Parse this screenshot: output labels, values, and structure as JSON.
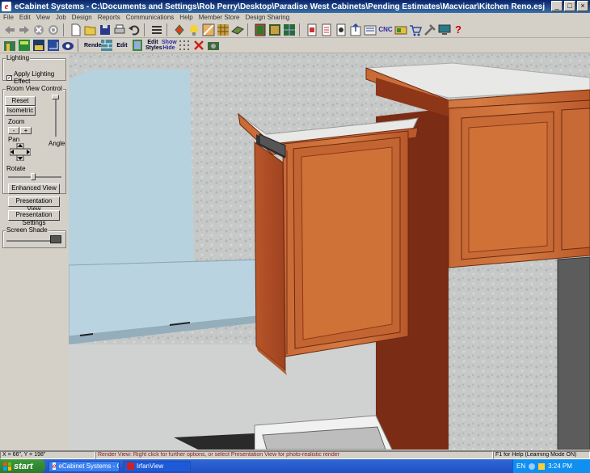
{
  "window": {
    "logo": "e",
    "title": "eCabinet Systems - C:\\Documents and Settings\\Rob Perry\\Desktop\\Paradise West Cabinets\\Pending Estimates\\Macvicar\\Kitchen Reno.esj",
    "minimize": "_",
    "maximize": "□",
    "close": "×"
  },
  "menu": [
    "File",
    "Edit",
    "View",
    "Job",
    "Design",
    "Reports",
    "Communications",
    "Help",
    "Member Store",
    "Design Sharing"
  ],
  "toolbar": {
    "cnc_label": "CNC",
    "help_label": "?",
    "render_label": "Render",
    "edit_label": "Edit",
    "edit_styles_label": "Edit Styles",
    "show_hide_label": "Show Hide"
  },
  "left_panel": {
    "lighting_title": "Lighting",
    "apply_lighting": "Apply Lighting Effect",
    "room_view_title": "Room View Control",
    "reset_view": "Reset View",
    "isometric": "Isometric",
    "zoom": "Zoom",
    "zoom_minus": "-",
    "zoom_plus": "+",
    "pan": "Pan",
    "angle": "Angle",
    "rotate": "Rotate",
    "enhanced_view": "Enhanced View",
    "presentation_view": "Presentation View",
    "presentation_settings": "Presentation Settings",
    "screen_shade": "Screen Shade"
  },
  "status": {
    "coords": "X = 66\", Y = 198\"",
    "message": "Render View: Right click for further options, or select Presentation View for photo-realistic render",
    "help": "F1 for Help (Learning Mode ON)"
  },
  "taskbar": {
    "start": "start",
    "task1": "eCabinet Systems - C...",
    "task2": "IrfanView",
    "lang": "EN",
    "time": "3:24 PM"
  },
  "colors": {
    "wall": "#c9cccb",
    "wood_light": "#c56a3a",
    "wood_dark": "#7a2c14",
    "countertop": "#b9d3e0"
  }
}
